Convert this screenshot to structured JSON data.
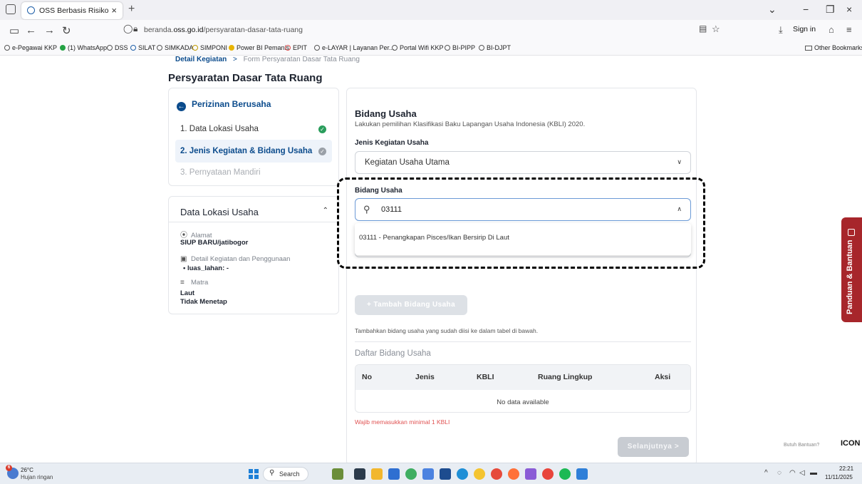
{
  "browser": {
    "tab_title": "OSS Berbasis Risiko",
    "tab_close": "×",
    "new_tab": "+",
    "url_prefix": "beranda.",
    "url_domain": "oss.go.id",
    "url_path": "/persyaratan-dasar-tata-ruang",
    "sign_in": "Sign in",
    "window_minimize": "−",
    "window_restore": "❐",
    "window_close": "×",
    "tab_list": "⌄",
    "bookmarks": [
      {
        "label": "e-Pegawai KKP",
        "color": "#555555"
      },
      {
        "label": "(1) WhatsApp",
        "color": "#25a244"
      },
      {
        "label": "DSS",
        "color": "#555555"
      },
      {
        "label": "SILAT",
        "color": "#1d5ea8"
      },
      {
        "label": "SIMKADA",
        "color": "#555555"
      },
      {
        "label": "SIMPONI",
        "color": "#c29b00"
      },
      {
        "label": "Power BI Pemanis",
        "color": "#e8b400"
      },
      {
        "label": "EPIT",
        "color": "#e05252"
      },
      {
        "label": "e-LAYAR | Layanan Per...",
        "color": "#555555"
      },
      {
        "label": "Portal Wifi KKP",
        "color": "#555555"
      },
      {
        "label": "BI-PIPP",
        "color": "#555555"
      },
      {
        "label": "BI-DJPT",
        "color": "#555555"
      }
    ],
    "other_bookmarks": "Other Bookmarks"
  },
  "breadcrumb": {
    "link": "Detail Kegiatan",
    "separator": ">",
    "current": "Form Persyaratan Dasar Tata Ruang"
  },
  "page_title": "Persyaratan Dasar Tata Ruang",
  "steps": {
    "back_label": "Perizinan Berusaha",
    "items": [
      {
        "label": "1. Data Lokasi Usaha",
        "status": "done"
      },
      {
        "label": "2. Jenis Kegiatan & Bidang Usaha",
        "status": "active"
      },
      {
        "label": "3. Pernyataan Mandiri",
        "status": "disabled"
      }
    ]
  },
  "location": {
    "title": "Data Lokasi Usaha",
    "alamat_label": "Alamat",
    "alamat_value": "SIUP BARU/jatibogor",
    "detail_label": "Detail Kegiatan dan Penggunaan",
    "detail_value": "• luas_lahan: -",
    "matra_label": "Matra",
    "matra_value_1": "Laut",
    "matra_value_2": "Tidak Menetap"
  },
  "form": {
    "section_title": "Bidang Usaha",
    "section_desc": "Lakukan pemilihan Klasifikasi Baku Lapangan Usaha Indonesia (KBLI) 2020.",
    "jenis_label": "Jenis Kegiatan Usaha",
    "jenis_value": "Kegiatan Usaha Utama",
    "bidang_label": "Bidang Usaha",
    "search_value": "03111",
    "dropdown_option": "03111 - Penangkapan Pisces/Ikan Bersirip Di Laut",
    "add_button": "+ Tambah Bidang Usaha",
    "hint": "Tambahkan bidang usaha yang sudah diisi ke dalam tabel di bawah.",
    "list_title": "Daftar Bidang Usaha",
    "table_headers": [
      "No",
      "Jenis",
      "KBLI",
      "Ruang Lingkup",
      "Aksi"
    ],
    "no_data": "No data available",
    "error": "Wajib memasukkan minimal 1 KBLI",
    "next_button": "Selanjutnya >"
  },
  "help": {
    "tab_label": "Panduan & Bantuan",
    "butuh": "Butuh Bantuan?",
    "icon_text": "ICON"
  },
  "taskbar": {
    "weather_badge": "6",
    "temperature": "26°C",
    "weather": "Hujan ringan",
    "search": "Search",
    "time": "22:21",
    "date": "11/11/2025"
  },
  "colors": {
    "primary": "#0b4b8c",
    "success": "#2a9d5c",
    "error": "#e05252",
    "help_tab": "#a7262b"
  }
}
